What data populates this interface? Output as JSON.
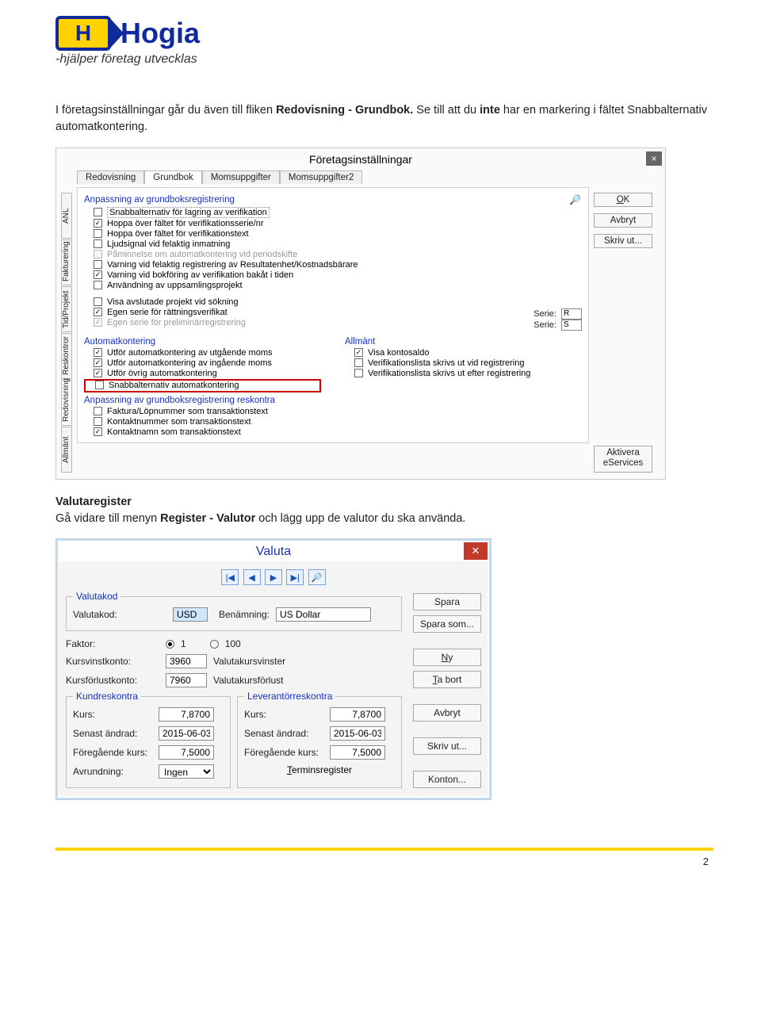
{
  "logo": {
    "h": "H",
    "word": "Hogia",
    "tag": "-hjälper företag utvecklas"
  },
  "para1": {
    "a": "I företagsinställningar går du även till fliken ",
    "b": "Redovisning - Grundbok.",
    "c": " Se till att du ",
    "d": "inte",
    "e": " har en markering i fältet Snabbalternativ automatkontering."
  },
  "shot1": {
    "title": "Företagsinställningar",
    "vtabs": [
      "ANL",
      "Fakturering",
      "Tid/Projekt",
      "Reskontror",
      "Redovisning",
      "Allmänt"
    ],
    "htabs": [
      "Redovisning",
      "Grundbok",
      "Momsuppgifter",
      "Momsuppgifter2"
    ],
    "sec1": "Anpassning av grundboksregistrering",
    "items1": [
      {
        "c": false,
        "t": "Snabbalternativ för lagring av verifikation",
        "boxed": true
      },
      {
        "c": true,
        "t": "Hoppa över fältet för verifikationsserie/nr"
      },
      {
        "c": false,
        "t": "Hoppa över fältet för verifikationstext"
      },
      {
        "c": false,
        "t": "Ljudsignal vid felaktig inmatning"
      },
      {
        "c": false,
        "t": "Påminnelse om automatkontering vid periodskifte",
        "disabled": true
      },
      {
        "c": false,
        "t": "Varning vid felaktig registrering av Resultatenhet/Kostnadsbärare"
      },
      {
        "c": true,
        "t": "Varning vid bokföring av verifikation bakåt i tiden"
      },
      {
        "c": false,
        "t": "Användning av uppsamlingsprojekt"
      }
    ],
    "items1b": [
      {
        "c": false,
        "t": "Visa avslutade projekt vid sökning"
      },
      {
        "c": true,
        "t": "Egen serie för rättningsverifikat"
      },
      {
        "c": true,
        "t": "Egen serie för preliminärregistrering",
        "disabled": true
      }
    ],
    "serie_lbl": "Serie:",
    "serie1": "R",
    "serie2": "S",
    "sec2a": "Automatkontering",
    "sec2b": "Allmänt",
    "auto": [
      {
        "c": true,
        "t": "Utför automatkontering av utgående moms"
      },
      {
        "c": true,
        "t": "Utför automatkontering av ingående moms"
      },
      {
        "c": true,
        "t": "Utför övrig automatkontering"
      },
      {
        "c": false,
        "t": "Snabbalternativ automatkontering",
        "red": true
      }
    ],
    "allm": [
      {
        "c": true,
        "t": "Visa kontosaldo"
      },
      {
        "c": false,
        "t": "Verifikationslista skrivs ut vid registrering"
      },
      {
        "c": false,
        "t": "Verifikationslista skrivs ut efter registrering"
      }
    ],
    "sec3": "Anpassning av grundboksregistrering reskontra",
    "resk": [
      {
        "c": false,
        "t": "Faktura/Löpnummer som transaktionstext"
      },
      {
        "c": false,
        "t": "Kontaktnummer som transaktionstext"
      },
      {
        "c": true,
        "t": "Kontaktnamn som transaktionstext"
      }
    ],
    "btns": {
      "ok": "OK",
      "avbryt": "Avbryt",
      "skriv": "Skriv ut...",
      "akt1": "Aktivera",
      "akt2": "eServices"
    }
  },
  "para2": {
    "head": "Valutaregister",
    "a": "Gå vidare till menyn ",
    "b": "Register - Valutor",
    "c": " och lägg upp de valutor du ska använda."
  },
  "shot2": {
    "title": "Valuta",
    "fs_kod": "Valutakod",
    "lbl_code": "Valutakod:",
    "code": "USD",
    "lbl_name": "Benämning:",
    "name": "US Dollar",
    "lbl_factor": "Faktor:",
    "f1": "1",
    "f100": "100",
    "lbl_vinst": "Kursvinstkonto:",
    "vinst": "3960",
    "vinst_txt": "Valutakursvinster",
    "lbl_forl": "Kursförlustkonto:",
    "forl": "7960",
    "forl_txt": "Valutakursförlust",
    "fs_kund": "Kundreskontra",
    "fs_lev": "Leverantörreskontra",
    "lbl_kurs": "Kurs:",
    "k1": "7,8700",
    "k2": "7,8700",
    "lbl_sen": "Senast ändrad:",
    "d1": "2015-06-03",
    "d2": "2015-06-03",
    "lbl_fg": "Föregående kurs:",
    "fg1": "7,5000",
    "fg2": "7,5000",
    "lbl_avr": "Avrundning:",
    "avr": "Ingen",
    "term": "Terminsregister",
    "btns": {
      "spara": "Spara",
      "sparas": "Spara som...",
      "ny": "Ny",
      "ta": "Ta bort",
      "avbryt": "Avbryt",
      "skriv": "Skriv ut...",
      "konton": "Konton..."
    }
  },
  "pagenum": "2"
}
